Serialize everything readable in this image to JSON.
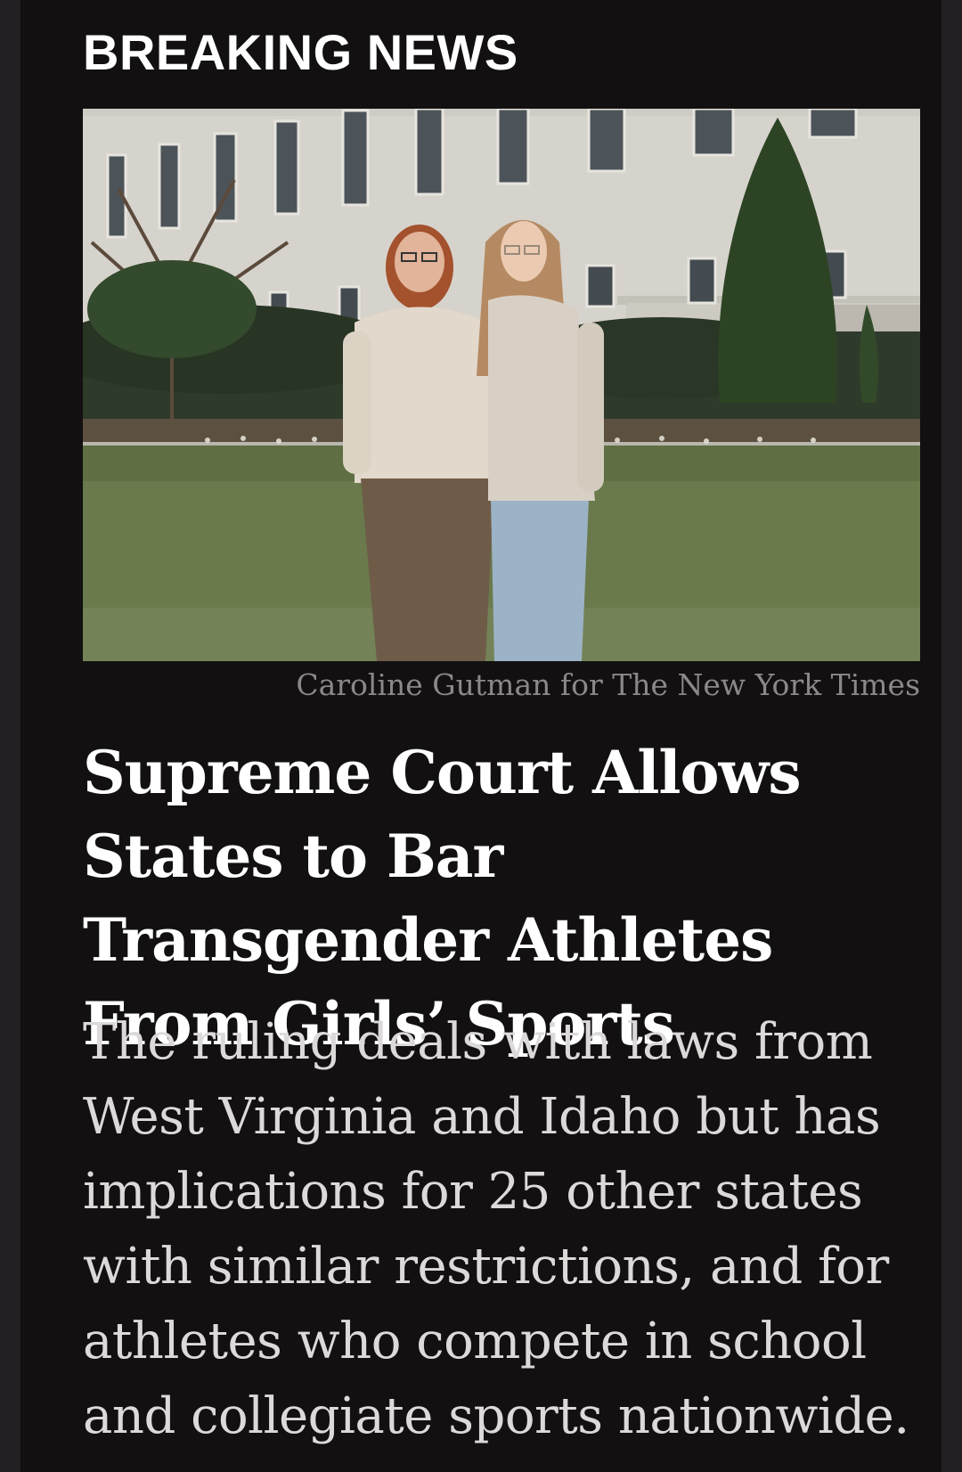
{
  "article": {
    "kicker": "BREAKING NEWS",
    "photo_credit": "Caroline Gutman for The New York Times",
    "headline": "Supreme Court Allows States to Bar Transgender Athletes From Girls’ Sports",
    "summary": "The ruling deals with laws from West Virginia and Idaho but has implications for 25 other states with similar restrictions, and for athletes who compete in school and collegiate sports nationwide."
  },
  "colors": {
    "page_background": "#241f22",
    "card_background": "#121011",
    "headline_text": "#ffffff",
    "summary_text": "#dcd9d9",
    "credit_text": "#8b8889"
  }
}
